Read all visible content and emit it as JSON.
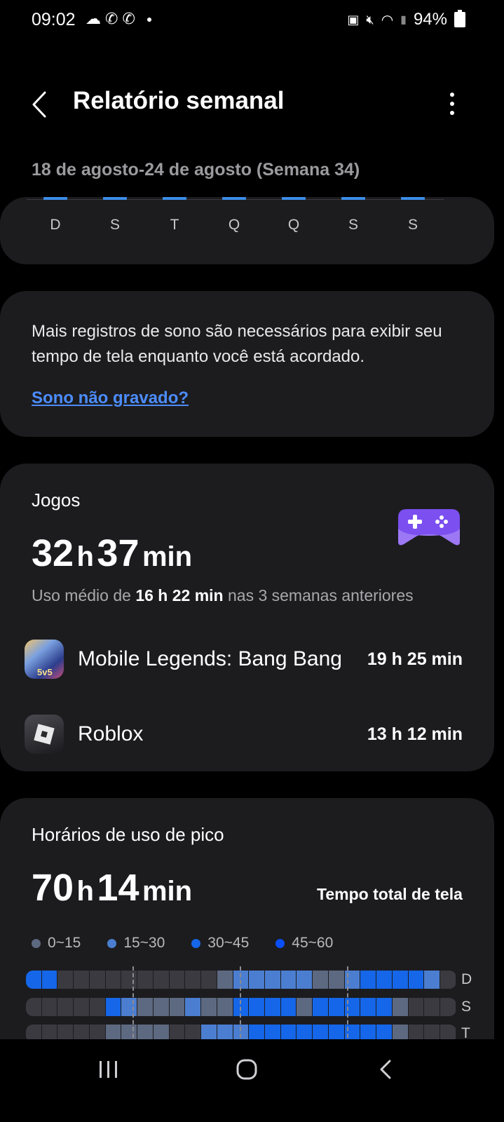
{
  "status_bar": {
    "time": "09:02",
    "battery": "94%"
  },
  "header": {
    "title": "Relatório semanal"
  },
  "week_range": "18 de agosto-24 de agosto (Semana 34)",
  "days": [
    "D",
    "S",
    "T",
    "Q",
    "Q",
    "S",
    "S"
  ],
  "notice": {
    "text": "Mais registros de sono são necessários para exibir seu tempo de tela enquanto você está acordado.",
    "link": "Sono não gravado?"
  },
  "games": {
    "title": "Jogos",
    "hours": "32",
    "h_unit": "h",
    "minutes": "37",
    "m_unit": "min",
    "avg_prefix": "Uso médio de ",
    "avg_value": "16 h 22 min",
    "avg_suffix": " nas 3 semanas anteriores",
    "apps": [
      {
        "name": "Mobile Legends: Bang Bang",
        "time": "19 h 25 min"
      },
      {
        "name": "Roblox",
        "time": "13 h 12 min"
      }
    ]
  },
  "peak": {
    "title": "Horários de uso de pico",
    "hours": "70",
    "h_unit": "h",
    "minutes": "14",
    "m_unit": "min",
    "label": "Tempo total de tela",
    "legend": [
      {
        "label": "0~15",
        "color": "#5d6980"
      },
      {
        "label": "15~30",
        "color": "#4b7ed0"
      },
      {
        "label": "30~45",
        "color": "#1566e8"
      },
      {
        "label": "45~60",
        "color": "#0a4ff5"
      }
    ],
    "rows": [
      {
        "label": "D",
        "cells": [
          3,
          3,
          0,
          0,
          0,
          0,
          0,
          0,
          0,
          0,
          0,
          0,
          1,
          2,
          2,
          2,
          2,
          2,
          1,
          1,
          2,
          3,
          3,
          3,
          3,
          2,
          0
        ]
      },
      {
        "label": "S",
        "cells": [
          0,
          0,
          0,
          0,
          0,
          3,
          2,
          1,
          1,
          1,
          2,
          1,
          1,
          3,
          3,
          3,
          3,
          1,
          3,
          3,
          3,
          3,
          3,
          1,
          0,
          0,
          0
        ]
      },
      {
        "label": "T",
        "cells": [
          0,
          0,
          0,
          0,
          0,
          1,
          1,
          1,
          1,
          0,
          0,
          2,
          2,
          2,
          3,
          3,
          3,
          3,
          3,
          3,
          3,
          3,
          3,
          1,
          0,
          0,
          0
        ]
      }
    ]
  },
  "colors": {
    "accent": "#3d8ee8",
    "link": "#4c8dff",
    "card_bg": "#1c1c1f",
    "empty_cell": "#3a3a40",
    "gamepad": "#7b4ff0"
  }
}
